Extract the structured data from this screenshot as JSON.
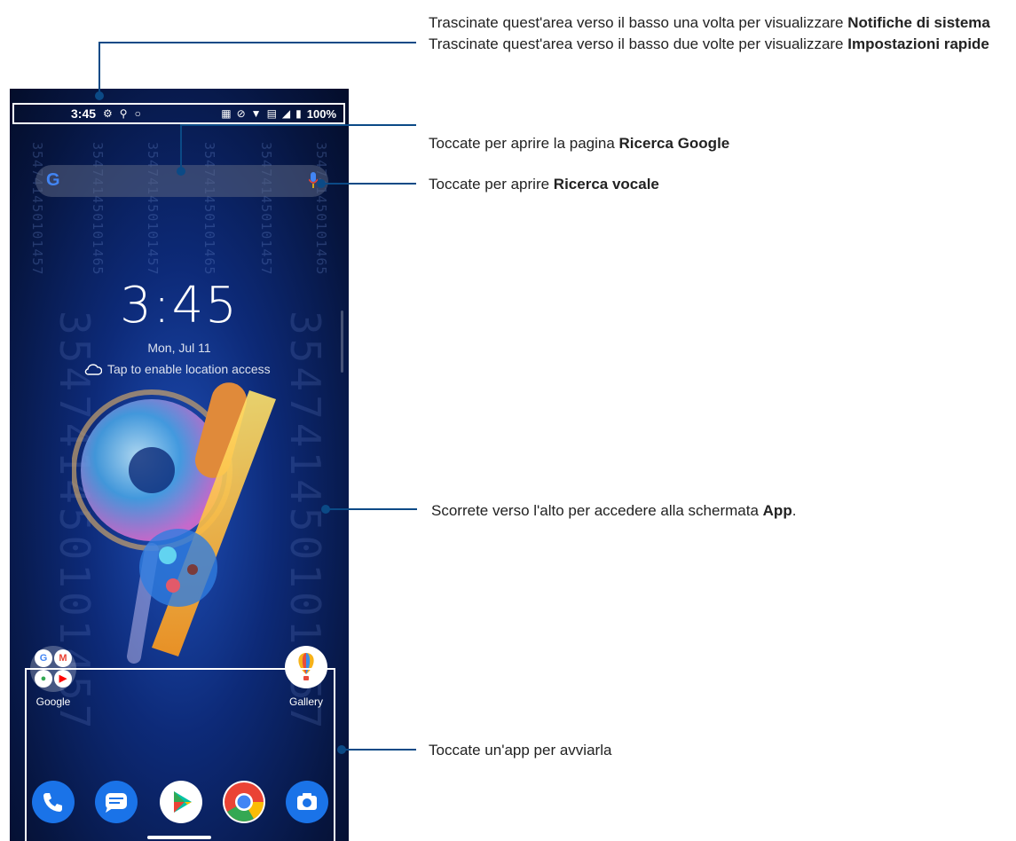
{
  "status_bar": {
    "time": "3:45",
    "battery": "100%",
    "icons": [
      "gear-icon",
      "pin-icon",
      "bulb-icon",
      "keyboard-icon",
      "mute-icon",
      "wifi-icon",
      "volte-icon",
      "signal-icon",
      "battery-icon"
    ]
  },
  "home": {
    "clock": "3:45",
    "date": "Mon, Jul 11",
    "weather_text": "Tap to enable location access",
    "watermark_digits": "354741450101457",
    "watermark_digits_2": "354741450101465",
    "apps": {
      "google_label": "Google",
      "gallery_label": "Gallery"
    },
    "dock": [
      "phone-app-icon",
      "messages-app-icon",
      "play-store-icon",
      "chrome-icon",
      "camera-icon"
    ]
  },
  "callouts": {
    "status": {
      "line1_pre": "Trascinate quest'area verso il basso una volta per visualizzare ",
      "line1_bold": "Notifiche di sistema",
      "line2_pre": "Trascinate quest'area verso il basso due volte per visualizzare ",
      "line2_bold": "Impostazioni rapide"
    },
    "search": {
      "pre": "Toccate per aprire la pagina ",
      "bold": "Ricerca Google"
    },
    "voice": {
      "pre": "Toccate per aprire ",
      "bold": "Ricerca vocale"
    },
    "apps_screen": {
      "pre": "Scorrete verso l'alto per accedere alla schermata ",
      "bold": "App",
      "post": "."
    },
    "launch": {
      "text": "Toccate un'app per avviarla"
    }
  },
  "colors": {
    "callout_line": "#0b4a86",
    "background": "#ffffff"
  }
}
